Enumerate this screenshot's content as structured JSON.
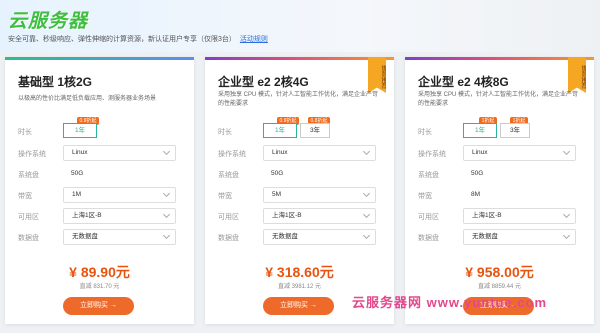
{
  "header": {
    "title": "云服务器",
    "subtitle": "安全可靠、秒级响应、弹性伸缩的计算资源，新认证用户专享（仅限3台）",
    "rules_link": "活动规则"
  },
  "labels": {
    "duration": "时长",
    "os": "操作系统",
    "system_disk": "系统盘",
    "bandwidth": "带宽",
    "zone": "可用区",
    "data_disk": "数据盘",
    "buy": "立即购买 →"
  },
  "cards": [
    {
      "name": "基础型 1核2G",
      "desc": "以极高的性价比满足低负载应用、测服务器业务场景",
      "ribbon": "",
      "durations": [
        {
          "label": "1年",
          "badge": "0.9折起"
        }
      ],
      "os": "Linux",
      "system_disk": "50G",
      "bandwidth": "1M",
      "zone": "上海1区-B",
      "data_disk": "无数据盘",
      "price": "¥ 89.90元",
      "direct": "直减 831.70 元"
    },
    {
      "name": "企业型 e2 2核4G",
      "desc": "采用独享 CPU 模式，针对人工智能工作优化，满足企业严苛的性能要求",
      "ribbon": "爆款推荐",
      "durations": [
        {
          "label": "1年",
          "badge": "0.9折起"
        },
        {
          "label": "3年",
          "badge": "0.8折起"
        }
      ],
      "os": "Linux",
      "system_disk": "50G",
      "bandwidth": "5M",
      "zone": "上海1区-B",
      "data_disk": "无数据盘",
      "price": "¥ 318.60元",
      "direct": "直减 3981.12 元"
    },
    {
      "name": "企业型 e2 4核8G",
      "desc": "采用独享 CPU 模式，针对人工智能工作优化，满足企业严苛的性能要求",
      "ribbon": "爆款推荐",
      "durations": [
        {
          "label": "1年",
          "badge": "1折起"
        },
        {
          "label": "3年",
          "badge": "1折起"
        }
      ],
      "os": "Linux",
      "system_disk": "50G",
      "bandwidth": "8M",
      "zone": "上海1区-B",
      "data_disk": "无数据盘",
      "price": "¥ 958.00元",
      "direct": "直减 8859.44 元"
    }
  ],
  "watermark": "云服务器网 www.yuntue.com"
}
